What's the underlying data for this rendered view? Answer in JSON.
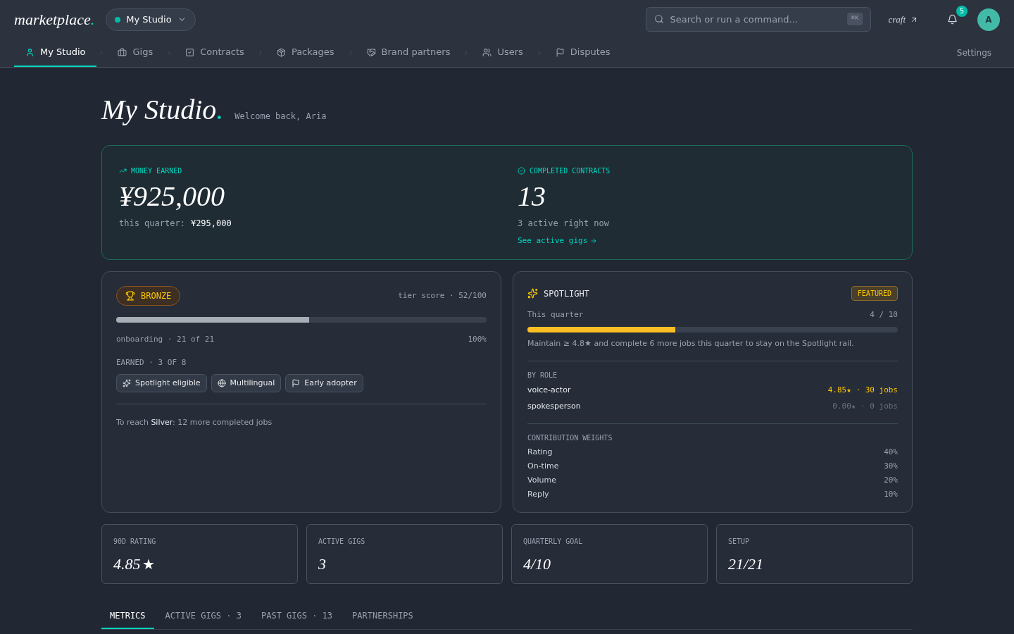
{
  "header": {
    "logo": {
      "name": "marketplace",
      "dot": "."
    },
    "workspace": {
      "label": "My Studio"
    },
    "search": {
      "placeholder": "Search or run a command...",
      "shortcut": "⌘K"
    },
    "craft_link": "craft",
    "notifications": "5",
    "avatar": "A"
  },
  "nav": {
    "items": [
      {
        "label": "My Studio",
        "selected": true
      },
      {
        "label": "Gigs",
        "selected": false
      },
      {
        "label": "Contracts",
        "selected": false
      },
      {
        "label": "Packages",
        "selected": false
      },
      {
        "label": "Brand partners",
        "selected": false
      },
      {
        "label": "Users",
        "selected": false
      },
      {
        "label": "Disputes",
        "selected": false
      }
    ],
    "settings": "Settings"
  },
  "page": {
    "title": "My Studio",
    "title_dot": ".",
    "welcome": "Welcome back, Aria"
  },
  "summary": {
    "money": {
      "label": "MONEY EARNED",
      "value": "¥925,000",
      "sub_label": "this quarter:",
      "sub_value": "¥295,000"
    },
    "contracts": {
      "label": "COMPLETED CONTRACTS",
      "value": "13",
      "sub": "3 active right now",
      "link": "See active gigs"
    }
  },
  "tier": {
    "badge": "BRONZE",
    "score": "tier score · 52/100",
    "level": 0.52,
    "onboarding": "onboarding · 21 of 21",
    "onboarding_pct": "100%",
    "earned_label": "EARNED · 3 OF 8",
    "chips": [
      "Spotlight eligible",
      "Multilingual",
      "Early adopter"
    ],
    "next": "To reach **Silver**: 12 more completed jobs"
  },
  "spotlight": {
    "title": "SPOTLIGHT",
    "badge": "FEATURED",
    "period": "This quarter",
    "count": "4 / 10",
    "level": 0.4,
    "note": "Maintain ≥ 4.8★ and complete 6 more jobs this quarter to stay on the Spotlight rail.",
    "roles_label": "BY ROLE",
    "roles": [
      {
        "name": "voice-actor",
        "value": "4.85★ · 30 jobs",
        "highlighted": true
      },
      {
        "name": "spokesperson",
        "value": "0.00★ · 0 jobs",
        "highlighted": false
      }
    ],
    "weights_label": "CONTRIBUTION WEIGHTS",
    "weights": [
      {
        "name": "Rating",
        "value": "40%"
      },
      {
        "name": "On-time",
        "value": "30%"
      },
      {
        "name": "Volume",
        "value": "20%"
      },
      {
        "name": "Reply",
        "value": "10%"
      }
    ]
  },
  "stats": [
    {
      "label": "90D RATING",
      "value": "4.85",
      "star": "★"
    },
    {
      "label": "ACTIVE GIGS",
      "value": "3"
    },
    {
      "label": "QUARTERLY GOAL",
      "value": "4/10"
    },
    {
      "label": "SETUP",
      "value": "21/21"
    }
  ],
  "tabs": [
    {
      "label": "METRICS",
      "selected": true
    },
    {
      "label": "ACTIVE GIGS · 3",
      "selected": false
    },
    {
      "label": "PAST GIGS · 13",
      "selected": false
    },
    {
      "label": "PARTNERSHIPS",
      "selected": false
    }
  ]
}
